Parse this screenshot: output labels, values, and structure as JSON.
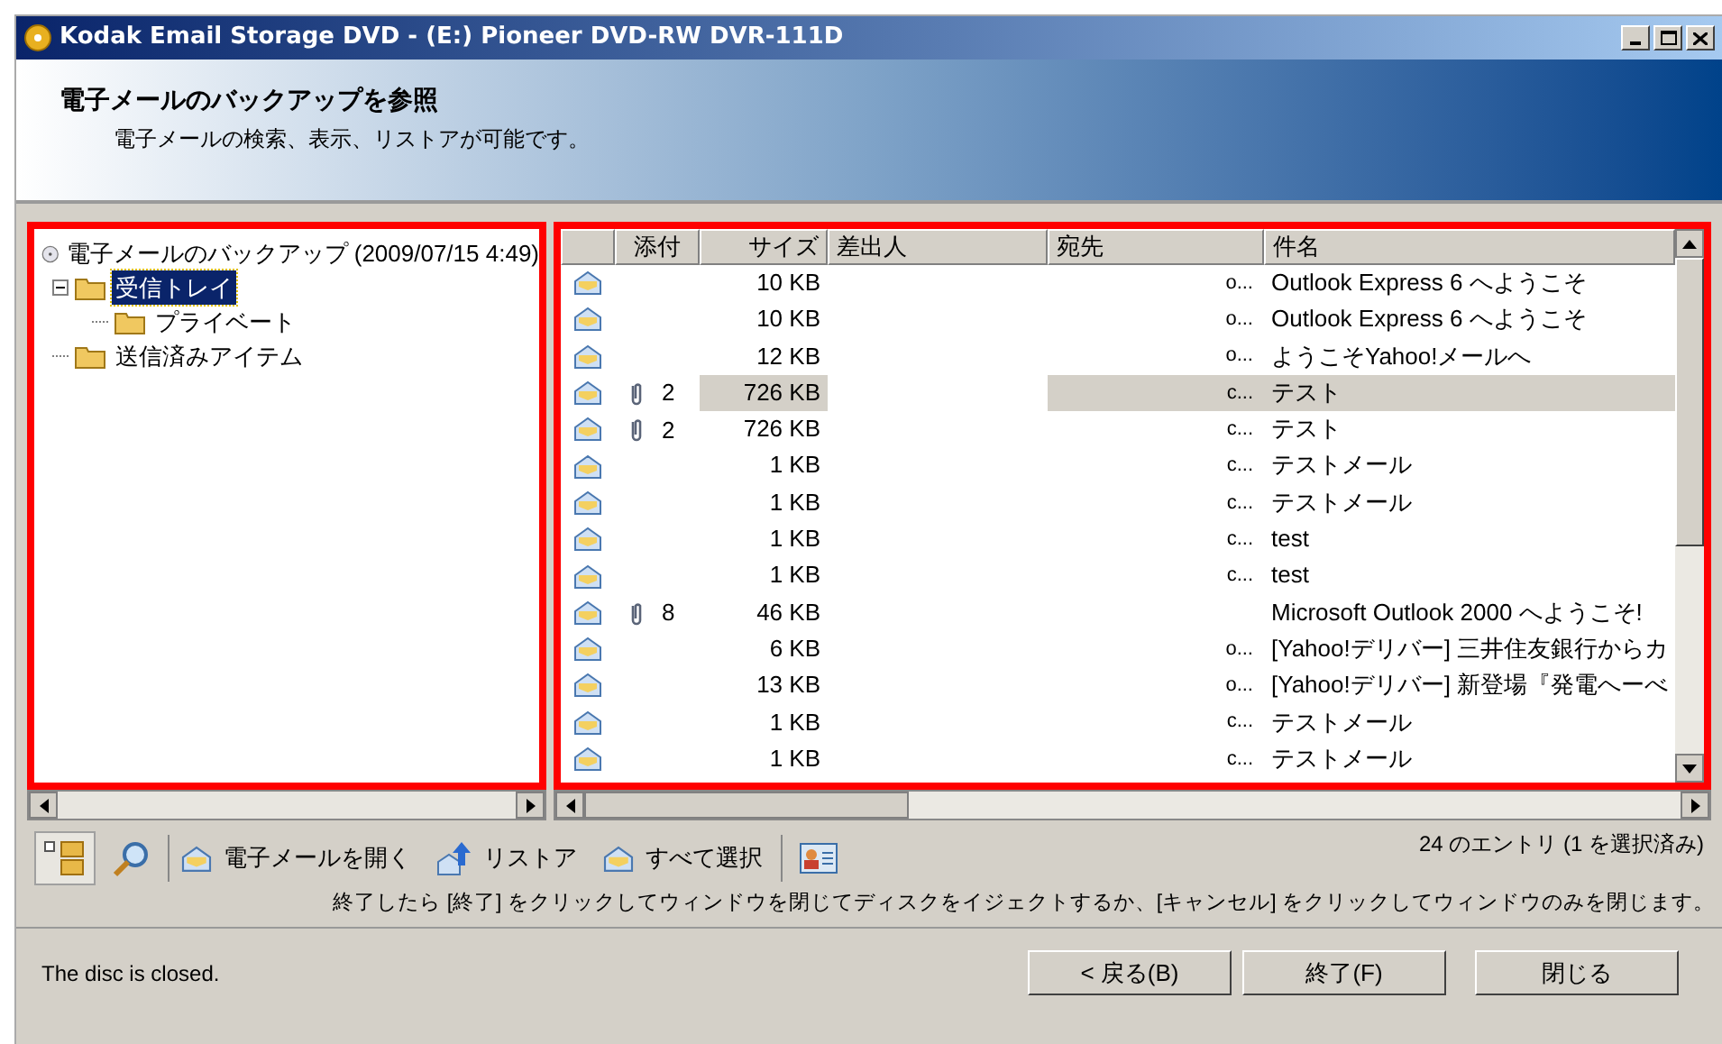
{
  "window": {
    "title": "Kodak Email Storage DVD - (E:) Pioneer DVD-RW DVR-111D"
  },
  "header": {
    "title": "電子メールのバックアップを参照",
    "subtitle": "電子メールの検索、表示、リストアが可能です。"
  },
  "tree": {
    "label": "電子メールのバックアップ (2009/07/15 4:49)",
    "children": [
      {
        "label": "受信トレイ",
        "selected": true,
        "expanded": true,
        "children": [
          {
            "label": "プライベート",
            "selected": false
          }
        ]
      },
      {
        "label": "送信済みアイテム",
        "selected": false
      }
    ]
  },
  "table": {
    "columns": [
      "添付",
      "サイズ",
      "差出人",
      "宛先",
      "件名"
    ],
    "rows": [
      {
        "attached": false,
        "count": "",
        "size": "10 KB",
        "to": "o...",
        "subject": "Outlook Express 6 へようこそ",
        "selected": false
      },
      {
        "attached": false,
        "count": "",
        "size": "10 KB",
        "to": "o...",
        "subject": "Outlook Express 6 へようこそ",
        "selected": false
      },
      {
        "attached": false,
        "count": "",
        "size": "12 KB",
        "to": "o...",
        "subject": "ようこそYahoo!メールへ",
        "selected": false
      },
      {
        "attached": true,
        "count": "2",
        "size": "726 KB",
        "to": "c...",
        "subject": "テスト",
        "selected": true
      },
      {
        "attached": true,
        "count": "2",
        "size": "726 KB",
        "to": "c...",
        "subject": "テスト",
        "selected": false
      },
      {
        "attached": false,
        "count": "",
        "size": "1 KB",
        "to": "c...",
        "subject": "テストメール",
        "selected": false
      },
      {
        "attached": false,
        "count": "",
        "size": "1 KB",
        "to": "c...",
        "subject": "テストメール",
        "selected": false
      },
      {
        "attached": false,
        "count": "",
        "size": "1 KB",
        "to": "c...",
        "subject": "test",
        "selected": false
      },
      {
        "attached": false,
        "count": "",
        "size": "1 KB",
        "to": "c...",
        "subject": "test",
        "selected": false
      },
      {
        "attached": true,
        "count": "8",
        "size": "46 KB",
        "to": "",
        "subject": "Microsoft Outlook 2000 へようこそ!",
        "selected": false
      },
      {
        "attached": false,
        "count": "",
        "size": "6 KB",
        "to": "o...",
        "subject": "[Yahoo!デリバー] 三井住友銀行からカ",
        "selected": false
      },
      {
        "attached": false,
        "count": "",
        "size": "13 KB",
        "to": "o...",
        "subject": "[Yahoo!デリバー] 新登場『発電へーべ",
        "selected": false
      },
      {
        "attached": false,
        "count": "",
        "size": "1 KB",
        "to": "c...",
        "subject": "テストメール",
        "selected": false
      },
      {
        "attached": false,
        "count": "",
        "size": "1 KB",
        "to": "c...",
        "subject": "テストメール",
        "selected": false
      }
    ]
  },
  "toolbar": {
    "buttons": [
      {
        "kind": "open",
        "label": "電子メールを開く"
      },
      {
        "kind": "restore",
        "label": "リストア"
      },
      {
        "kind": "selectall",
        "label": "すべて選択"
      }
    ],
    "entry_count": "24 のエントリ (1 を選択済み)"
  },
  "instruction": "終了したら [終了] をクリックしてウィンドウを閉じてディスクをイジェクトするか、[キャンセル] をクリックしてウィンドウのみを閉じます。",
  "status": "The disc is closed.",
  "buttons": [
    "< 戻る(B)",
    "終了(F)",
    "閉じる"
  ]
}
